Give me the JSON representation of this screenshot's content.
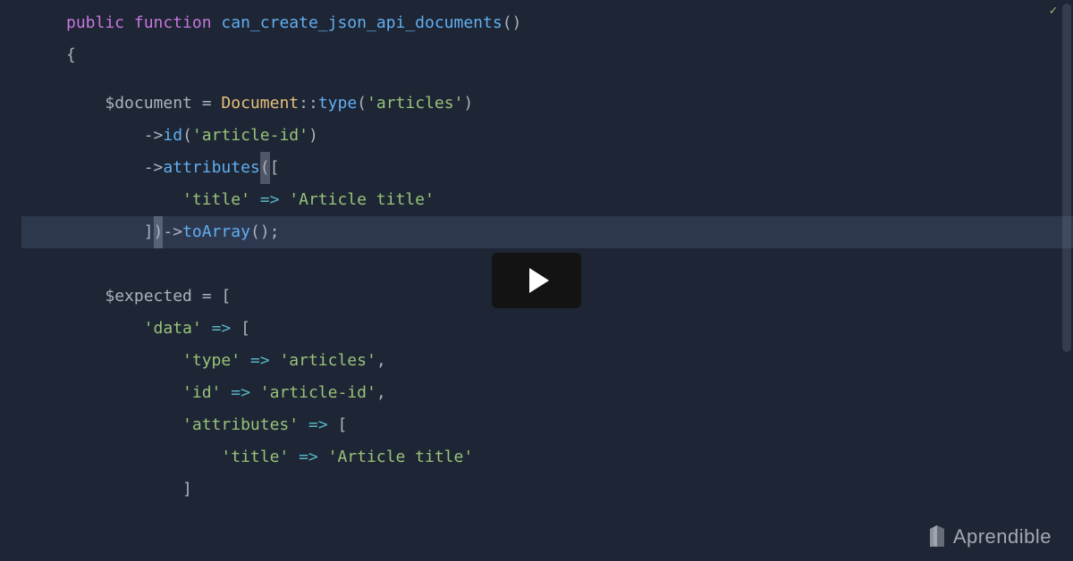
{
  "code": {
    "line1": {
      "kw1": "public",
      "kw2": "function",
      "fn": "can_create_json_api_documents",
      "parens": "()"
    },
    "line2": "{",
    "line3": {
      "var": "$document",
      "eq": " = ",
      "class": "Document",
      "sep": "::",
      "method": "type",
      "open": "(",
      "str": "'articles'",
      "close": ")"
    },
    "line4": {
      "arrow": "->",
      "method": "id",
      "open": "(",
      "str": "'article-id'",
      "close": ")"
    },
    "line5": {
      "arrow": "->",
      "method": "attributes",
      "open": "(",
      "bracket": "["
    },
    "line6": {
      "key": "'title'",
      "arrow": " => ",
      "val": "'Article title'"
    },
    "line7": {
      "bracket": "]",
      "close": ")",
      "arrow_part": "->",
      "method": "toArray",
      "parens": "();"
    },
    "line9": {
      "var": "$expected",
      "eq": " = ",
      "bracket": "["
    },
    "line10": {
      "key": "'data'",
      "arrow": " => ",
      "bracket": "["
    },
    "line11": {
      "key": "'type'",
      "arrow": " => ",
      "val": "'articles'",
      "comma": ","
    },
    "line12": {
      "key": "'id'",
      "arrow": " => ",
      "val": "'article-id'",
      "comma": ","
    },
    "line13": {
      "key": "'attributes'",
      "arrow": " => ",
      "bracket": "["
    },
    "line14": {
      "key": "'title'",
      "arrow": " => ",
      "val": "'Article title'"
    },
    "line15": "]"
  },
  "brand": {
    "name": "Aprendible"
  }
}
